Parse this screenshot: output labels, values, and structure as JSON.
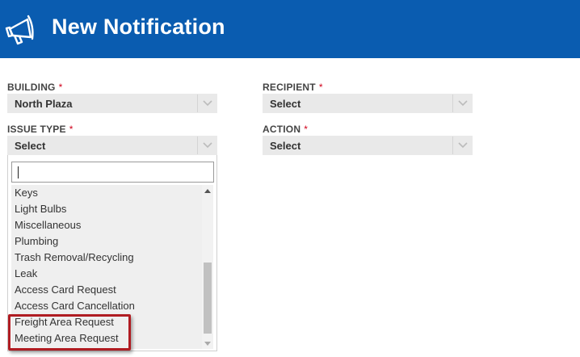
{
  "header": {
    "title": "New Notification",
    "icon": "megaphone-icon",
    "background": "#0a5cb0"
  },
  "form": {
    "building": {
      "label": "BUILDING",
      "required": "*",
      "value": "North Plaza"
    },
    "recipient": {
      "label": "RECIPIENT",
      "required": "*",
      "value": "Select"
    },
    "issue_type": {
      "label": "ISSUE TYPE",
      "required": "*",
      "value": "Select"
    },
    "action": {
      "label": "ACTION",
      "required": "*",
      "value": "Select"
    }
  },
  "dropdown": {
    "search_value": "",
    "items": [
      "Keys",
      "Light Bulbs",
      "Miscellaneous",
      "Plumbing",
      "Trash Removal/Recycling",
      "Leak",
      "Access Card Request",
      "Access Card Cancellation",
      "Freight Area Request",
      "Meeting Area Request"
    ],
    "highlighted_items": [
      "Freight Area Request",
      "Meeting Area Request"
    ],
    "highlight_color": "#b01c22"
  },
  "colors": {
    "required": "#d0021b",
    "select_bg": "#e9e9e9"
  }
}
